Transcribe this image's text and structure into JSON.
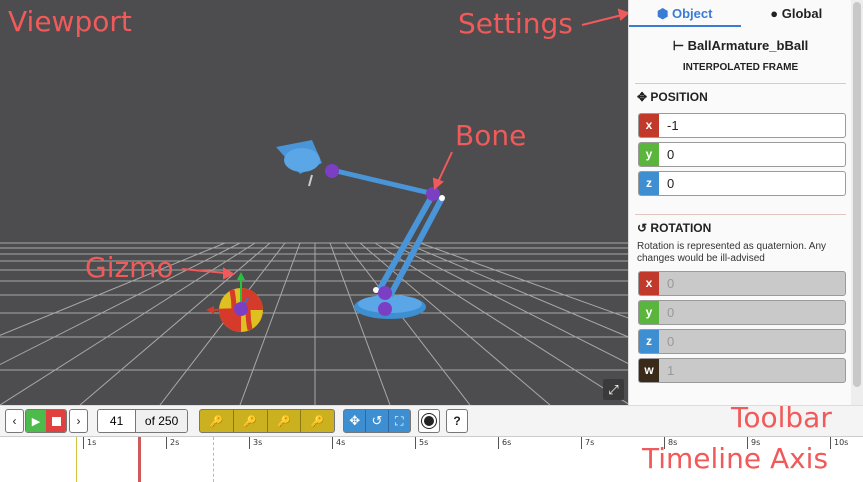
{
  "annotations": {
    "viewport": "Viewport",
    "settings": "Settings",
    "bone": "Bone",
    "gizmo": "Gizmo",
    "toolbar": "Toolbar",
    "timeline_axis": "Timeline Axis"
  },
  "settings": {
    "tabs": [
      {
        "label": "Object",
        "icon": "cube-icon",
        "active": true
      },
      {
        "label": "Global",
        "icon": "globe-icon",
        "active": false
      }
    ],
    "object_name": "BallArmature_bBall",
    "frame_type": "INTERPOLATED FRAME",
    "position": {
      "title": "POSITION",
      "x": "-1",
      "y": "0",
      "z": "0"
    },
    "rotation": {
      "title": "ROTATION",
      "note": "Rotation is represented as quaternion. Any changes would be ill-advised",
      "x": "0",
      "y": "0",
      "z": "0",
      "w": "1"
    },
    "axis_labels": {
      "x": "x",
      "y": "y",
      "z": "z",
      "w": "w"
    },
    "colors": {
      "x": "#c0392b",
      "y": "#5ab53c",
      "z": "#3d8fd1",
      "w": "#3a2a1a",
      "accent": "#3a7bd5"
    }
  },
  "toolbar": {
    "prev": "‹",
    "next": "›",
    "current_frame": "41",
    "total_frames": "of 250",
    "colors": {
      "play": "#4cbb4c",
      "stop": "#e04040",
      "keyframe_group": "#cbb11f",
      "transform_group": "#3d8fd1"
    }
  },
  "timeline": {
    "labels": [
      "1s",
      "2s",
      "3s",
      "4s",
      "5s",
      "6s",
      "7s",
      "8s",
      "9s",
      "10s"
    ]
  }
}
